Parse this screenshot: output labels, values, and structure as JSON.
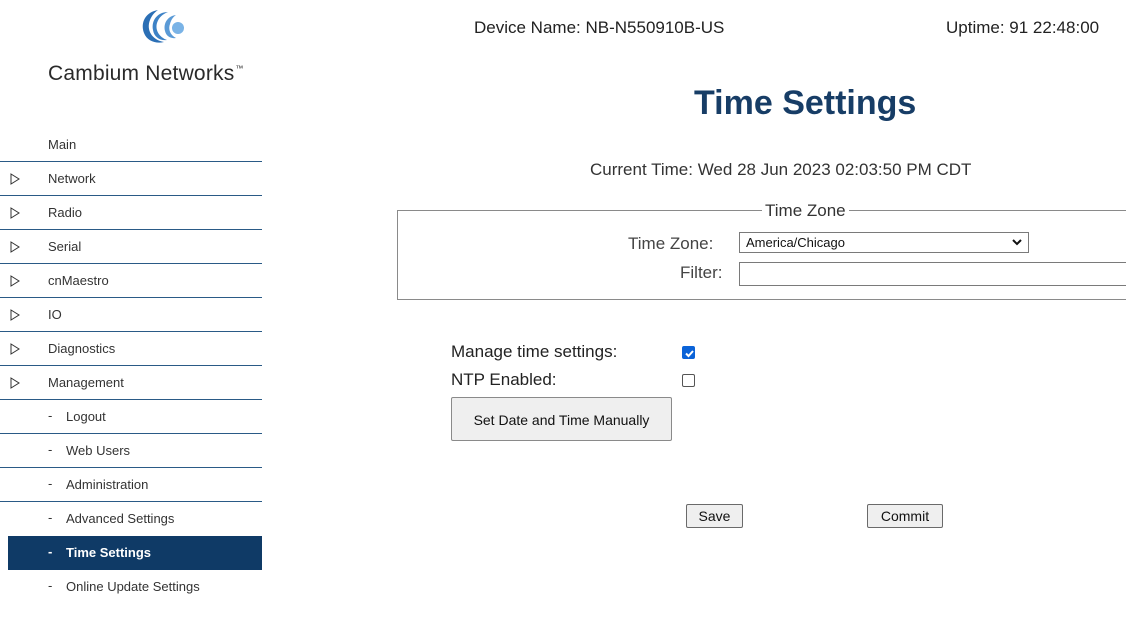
{
  "brand": {
    "name": "Cambium Networks",
    "trademark": "™"
  },
  "header": {
    "device_name": "Device Name: NB-N550910B-US",
    "uptime": "Uptime: 91 22:48:00"
  },
  "sidebar": {
    "items": [
      {
        "label": "Main",
        "arrow": false,
        "sub": false
      },
      {
        "label": "Network",
        "arrow": true,
        "sub": false
      },
      {
        "label": "Radio",
        "arrow": true,
        "sub": false
      },
      {
        "label": "Serial",
        "arrow": true,
        "sub": false
      },
      {
        "label": "cnMaestro",
        "arrow": true,
        "sub": false
      },
      {
        "label": "IO",
        "arrow": true,
        "sub": false
      },
      {
        "label": "Diagnostics",
        "arrow": true,
        "sub": false
      },
      {
        "label": "Management",
        "arrow": true,
        "sub": false
      },
      {
        "label": "Logout",
        "arrow": false,
        "sub": true
      },
      {
        "label": "Web Users",
        "arrow": false,
        "sub": true
      },
      {
        "label": "Administration",
        "arrow": false,
        "sub": true
      },
      {
        "label": "Advanced Settings",
        "arrow": false,
        "sub": true
      },
      {
        "label": "Time Settings",
        "arrow": false,
        "sub": true,
        "active": true
      },
      {
        "label": "Online Update Settings",
        "arrow": false,
        "sub": true
      }
    ],
    "sub_prefix": "-"
  },
  "main": {
    "title": "Time Settings",
    "current_time": "Current Time: Wed 28 Jun 2023 02:03:50 PM CDT",
    "timezone_group": {
      "legend": "Time Zone",
      "tz_label": "Time Zone:",
      "tz_value": "America/Chicago",
      "filter_label": "Filter:",
      "filter_value": ""
    },
    "options": {
      "manage_label": "Manage time settings:",
      "manage_checked": true,
      "ntp_label": "NTP Enabled:",
      "ntp_checked": false,
      "manual_button": "Set Date and Time Manually"
    },
    "actions": {
      "save": "Save",
      "commit": "Commit"
    }
  },
  "colors": {
    "accent": "#0f3a66",
    "title": "#173d66",
    "checkbox": "#0b63d8",
    "divider": "#2a5a86"
  },
  "icons": {
    "logo": "cambium-logo-icon",
    "nav_arrow": "triangle-right-icon",
    "select_arrow": "chevron-down-icon",
    "check": "check-icon"
  }
}
